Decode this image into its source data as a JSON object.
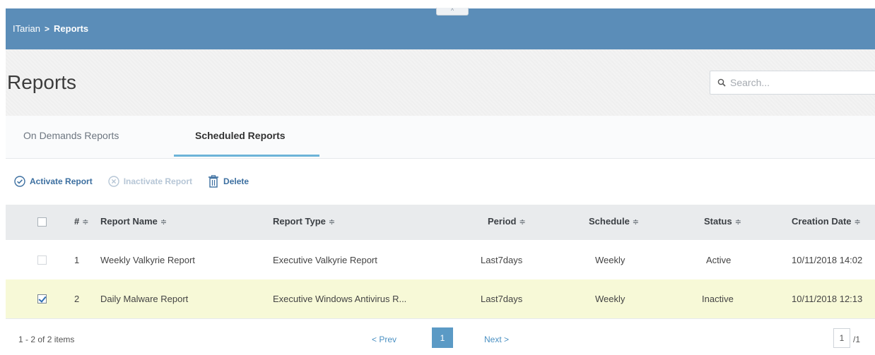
{
  "breadcrumb": {
    "root": "ITarian",
    "separator": ">",
    "current": "Reports"
  },
  "collapse_tab": {
    "glyph": "^"
  },
  "page": {
    "title": "Reports"
  },
  "search": {
    "placeholder": "Search..."
  },
  "tabs": [
    {
      "label": "On Demands Reports",
      "active": false
    },
    {
      "label": "Scheduled Reports",
      "active": true
    }
  ],
  "toolbar": {
    "activate_label": "Activate Report",
    "inactivate_label": "Inactivate Report",
    "delete_label": "Delete"
  },
  "table": {
    "columns": [
      "#",
      "Report Name",
      "Report Type",
      "Period",
      "Schedule",
      "Status",
      "Creation Date"
    ],
    "sort_glyph": "≑",
    "rows": [
      {
        "num": "1",
        "name": "Weekly Valkyrie Report",
        "type": "Executive Valkyrie Report",
        "period": "Last7days",
        "schedule": "Weekly",
        "status": "Active",
        "created": "10/11/2018 14:02",
        "checked": false,
        "highlighted": false
      },
      {
        "num": "2",
        "name": "Daily Malware Report",
        "type": "Executive Windows Antivirus R...",
        "period": "Last7days",
        "schedule": "Weekly",
        "status": "Inactive",
        "created": "10/11/2018 12:13",
        "checked": true,
        "highlighted": true
      }
    ]
  },
  "pagination": {
    "summary": "1 - 2 of 2 items",
    "prev_label": "< Prev",
    "next_label": "Next >",
    "current_page": "1",
    "page_input": "1",
    "page_total": "/1"
  },
  "colors": {
    "header_bar": "#5b8db8",
    "accent": "#3c6fa0",
    "tab_underline": "#6cb4d8",
    "selected_row": "#f7f9d7",
    "page_button": "#5b9ac5"
  }
}
